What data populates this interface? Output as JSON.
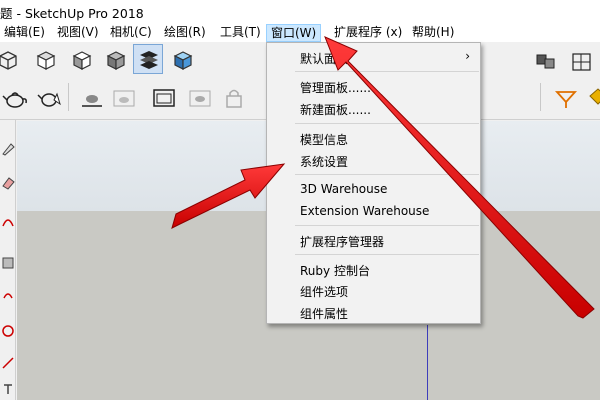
{
  "window": {
    "title": "题 - SketchUp Pro 2018"
  },
  "menubar": {
    "items": [
      {
        "label": "编辑(E)"
      },
      {
        "label": "视图(V)"
      },
      {
        "label": "相机(C)"
      },
      {
        "label": "绘图(R)"
      },
      {
        "label": "工具(T)"
      },
      {
        "label": "窗口(W)"
      },
      {
        "label": "扩展程序 (x)"
      },
      {
        "label": "帮助(H)"
      }
    ]
  },
  "dropdown": {
    "items": [
      {
        "label": "默认面板",
        "submenu_arrow": "›"
      },
      {
        "label": "管理面板......"
      },
      {
        "label": "新建面板......"
      },
      {
        "label": "模型信息"
      },
      {
        "label": "系统设置"
      },
      {
        "label": "3D Warehouse"
      },
      {
        "label": "Extension Warehouse"
      },
      {
        "label": "扩展程序管理器"
      },
      {
        "label": "Ruby 控制台"
      },
      {
        "label": "组件选项"
      },
      {
        "label": "组件属性"
      }
    ]
  },
  "colors": {
    "menu_highlight": "#cce8ff",
    "annotation_arrow": "#e00000",
    "ground": "#c9c9c4",
    "sky": "#e3e8ec"
  },
  "icons": {
    "toolbar_row1": [
      "cube-icon",
      "cube-top-icon",
      "cube-front-icon",
      "shaded-cube-icon",
      "styles-icon",
      "textured-cube-icon"
    ],
    "toolbar_row2": [
      "teapot-icon",
      "teapot-select-icon",
      "teapot-3d-icon",
      "teapot-frame-icon",
      "frame-icon",
      "teapot-box-icon",
      "lock-icon"
    ]
  }
}
